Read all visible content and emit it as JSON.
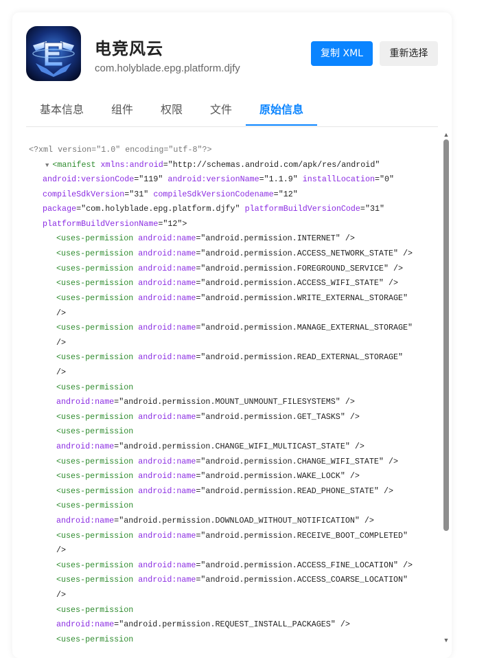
{
  "app": {
    "name": "电竞风云",
    "package": "com.holyblade.epg.platform.djfy"
  },
  "buttons": {
    "copy_xml": "复制 XML",
    "reselect": "重新选择"
  },
  "tabs": [
    {
      "label": "基本信息",
      "active": false
    },
    {
      "label": "组件",
      "active": false
    },
    {
      "label": "权限",
      "active": false
    },
    {
      "label": "文件",
      "active": false
    },
    {
      "label": "原始信息",
      "active": true
    }
  ],
  "colors": {
    "accent": "#0a84ff",
    "xml_tag": "#2e8b2e",
    "xml_attr": "#8a2be2"
  },
  "xml": {
    "declaration": "<?xml version=\"1.0\" encoding=\"utf-8\"?>",
    "manifest_attrs": [
      {
        "name": "xmlns:android",
        "value": "\"http://schemas.android.com/apk/res/android\""
      },
      {
        "name": "android:versionCode",
        "value": "\"119\""
      },
      {
        "name": "android:versionName",
        "value": "\"1.1.9\""
      },
      {
        "name": "installLocation",
        "value": "\"0\""
      },
      {
        "name": "compileSdkVersion",
        "value": "\"31\""
      },
      {
        "name": "compileSdkVersionCodename",
        "value": "\"12\""
      },
      {
        "name": "package",
        "value": "\"com.holyblade.epg.platform.djfy\""
      },
      {
        "name": "platformBuildVersionCode",
        "value": "\"31\""
      },
      {
        "name": "platformBuildVersionName",
        "value": "\"12\""
      }
    ],
    "permissions": [
      "\"android.permission.INTERNET\"",
      "\"android.permission.ACCESS_NETWORK_STATE\"",
      "\"android.permission.FOREGROUND_SERVICE\"",
      "\"android.permission.ACCESS_WIFI_STATE\"",
      "\"android.permission.WRITE_EXTERNAL_STORAGE\"",
      "\"android.permission.MANAGE_EXTERNAL_STORAGE\"",
      "\"android.permission.READ_EXTERNAL_STORAGE\"",
      "\"android.permission.MOUNT_UNMOUNT_FILESYSTEMS\"",
      "\"android.permission.GET_TASKS\"",
      "\"android.permission.CHANGE_WIFI_MULTICAST_STATE\"",
      "\"android.permission.CHANGE_WIFI_STATE\"",
      "\"android.permission.WAKE_LOCK\"",
      "\"android.permission.READ_PHONE_STATE\"",
      "\"android.permission.DOWNLOAD_WITHOUT_NOTIFICATION\"",
      "\"android.permission.RECEIVE_BOOT_COMPLETED\"",
      "\"android.permission.ACCESS_FINE_LOCATION\"",
      "\"android.permission.ACCESS_COARSE_LOCATION\"",
      "\"android.permission.REQUEST_INSTALL_PACKAGES\""
    ]
  }
}
